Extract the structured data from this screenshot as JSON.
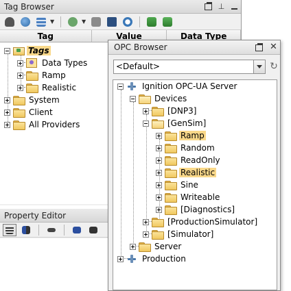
{
  "tag_browser": {
    "title": "Tag Browser",
    "columns": [
      "Tag",
      "Value",
      "Data Type"
    ],
    "tree": [
      {
        "label": "Tags",
        "expanded": true,
        "selected": true,
        "icon": "tags-folder-icon"
      },
      {
        "label": "Data Types",
        "icon": "data-types-icon"
      },
      {
        "label": "Ramp",
        "icon": "folder-icon"
      },
      {
        "label": "Realistic",
        "icon": "folder-icon"
      },
      {
        "label": "System",
        "icon": "folder-icon"
      },
      {
        "label": "Client",
        "icon": "folder-icon"
      },
      {
        "label": "All Providers",
        "icon": "folder-icon"
      }
    ]
  },
  "property_editor": {
    "title": "Property Editor"
  },
  "opc_browser": {
    "title": "OPC Browser",
    "provider_selected": "<Default>",
    "tree": [
      {
        "label": "Ignition OPC-UA Server",
        "icon": "opc-server-icon",
        "expanded": true
      },
      {
        "label": "Devices",
        "icon": "folder-icon",
        "expanded": true
      },
      {
        "label": "[DNP3]",
        "icon": "folder-icon"
      },
      {
        "label": "[GenSim]",
        "icon": "folder-icon",
        "expanded": true
      },
      {
        "label": "Ramp",
        "icon": "folder-icon",
        "highlighted": true
      },
      {
        "label": "Random",
        "icon": "folder-icon"
      },
      {
        "label": "ReadOnly",
        "icon": "folder-icon"
      },
      {
        "label": "Realistic",
        "icon": "folder-icon",
        "highlighted": true
      },
      {
        "label": "Sine",
        "icon": "folder-icon"
      },
      {
        "label": "Writeable",
        "icon": "folder-icon"
      },
      {
        "label": "[Diagnostics]",
        "icon": "folder-icon"
      },
      {
        "label": "[ProductionSimulator]",
        "icon": "folder-icon"
      },
      {
        "label": "[Simulator]",
        "icon": "folder-icon"
      },
      {
        "label": "Server",
        "icon": "folder-icon"
      },
      {
        "label": "Production",
        "icon": "opc-server-icon"
      }
    ]
  },
  "colors": {
    "highlight": "#f9d88a",
    "panel_bg": "#f0f0f0",
    "folder": "#f0c860"
  }
}
